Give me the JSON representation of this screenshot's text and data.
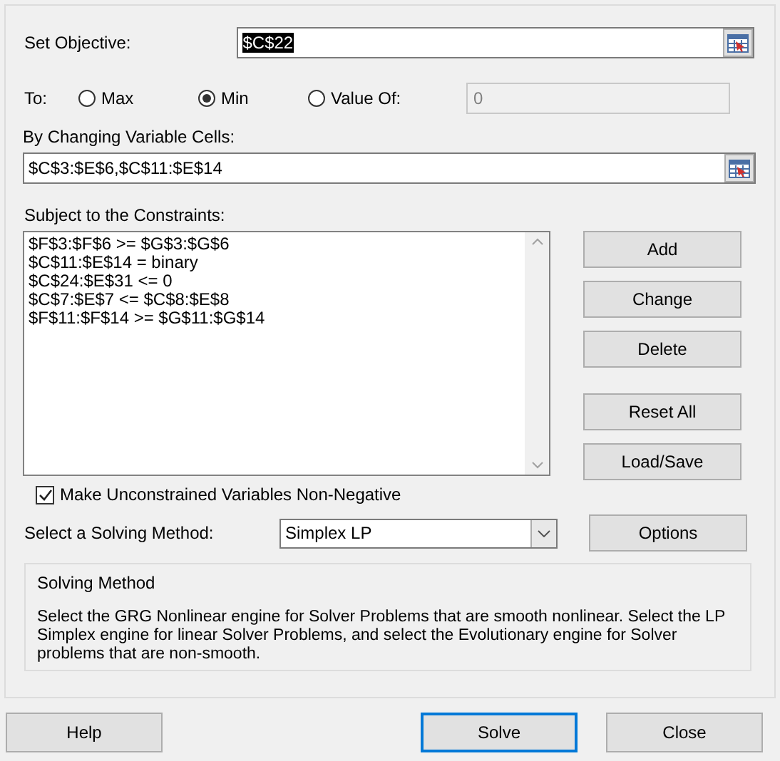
{
  "objective": {
    "label": "Set Objective:",
    "value": "$C$22",
    "selected": true
  },
  "to": {
    "label": "To:",
    "options": [
      {
        "label": "Max",
        "selected": false
      },
      {
        "label": "Min",
        "selected": true
      },
      {
        "label": "Value Of:",
        "selected": false
      }
    ],
    "value_of": {
      "value": "0",
      "disabled": true
    }
  },
  "changing_cells": {
    "label": "By Changing Variable Cells:",
    "value": "$C$3:$E$6,$C$11:$E$14"
  },
  "constraints": {
    "label": "Subject to the Constraints:",
    "items": [
      "$F$3:$F$6 >= $G$3:$G$6",
      "$C$11:$E$14 = binary",
      "$C$24:$E$31 <= 0",
      "$C$7:$E$7 <= $C$8:$E$8",
      "$F$11:$F$14 >= $G$11:$G$14"
    ]
  },
  "button_groups": [
    {
      "buttons": [
        "Add",
        "Change",
        "Delete"
      ]
    },
    {
      "buttons": [
        "Reset All",
        "Load/Save"
      ]
    }
  ],
  "non_negative": {
    "label": "Make Unconstrained Variables Non-Negative",
    "checked": true
  },
  "method": {
    "label": "Select a Solving Method:",
    "value": "Simplex LP"
  },
  "options_button": "Options",
  "description": {
    "title": "Solving Method",
    "text": "Select the GRG Nonlinear engine for Solver Problems that are smooth nonlinear. Select the LP Simplex engine for linear Solver Problems, and select the Evolutionary engine for Solver problems that are non-smooth."
  },
  "footer_buttons": [
    {
      "label": "Help",
      "default": false
    },
    {
      "label": "Solve",
      "default": true
    },
    {
      "label": "Close",
      "default": false
    }
  ]
}
